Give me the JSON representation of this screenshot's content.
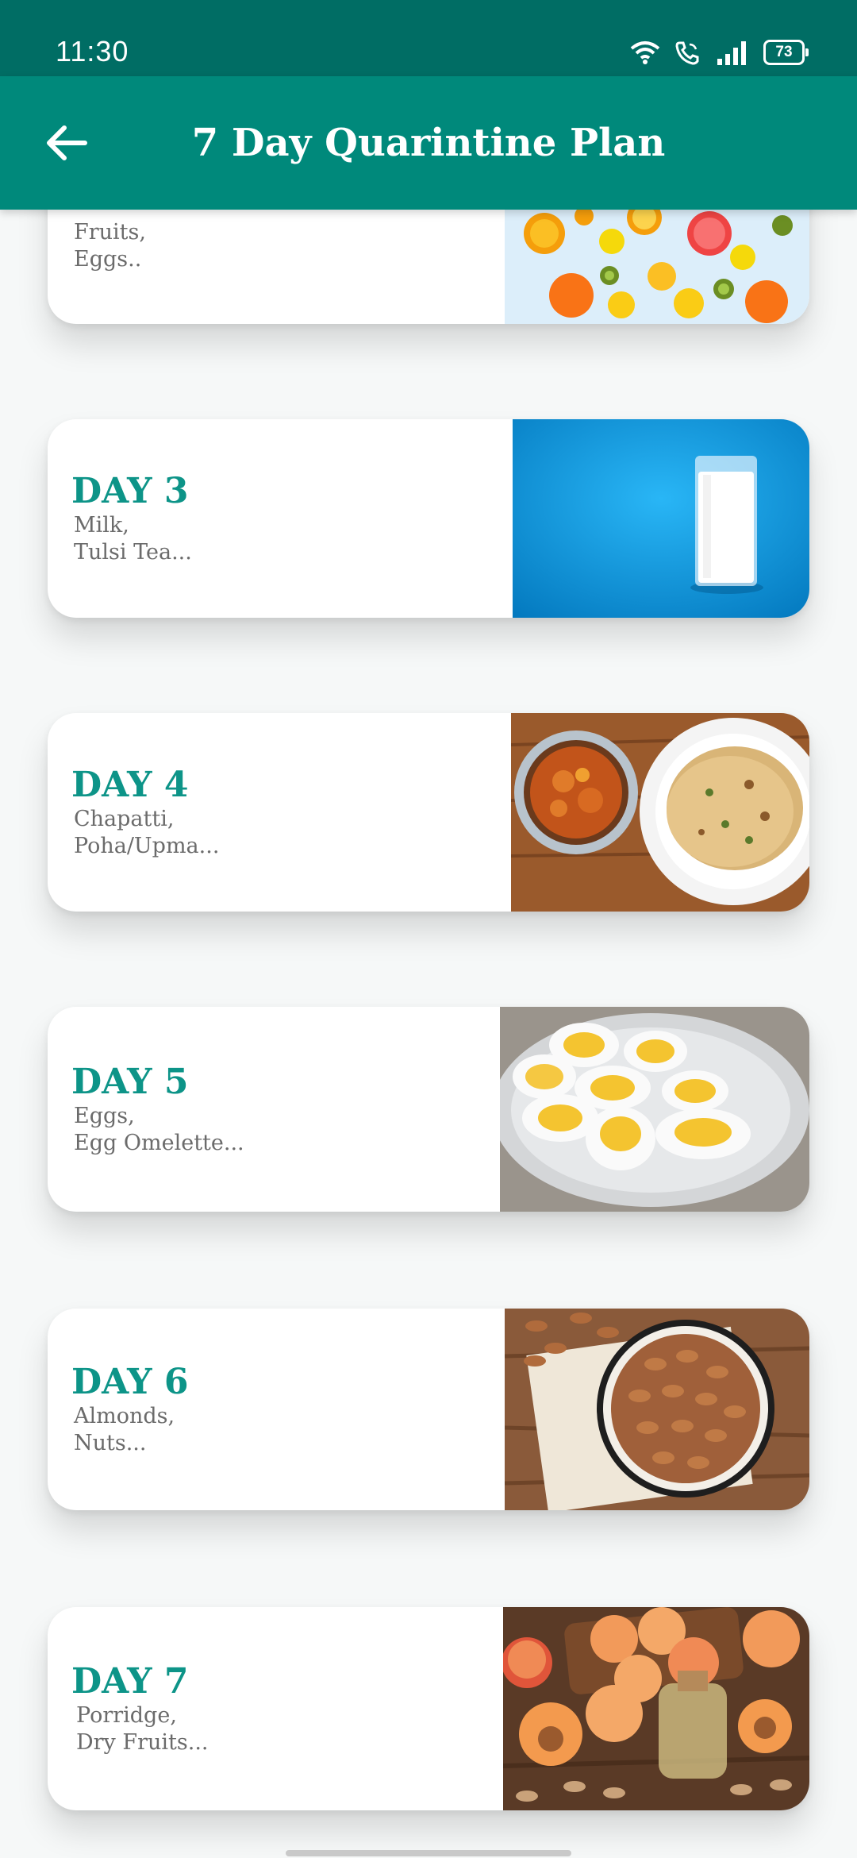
{
  "status_bar": {
    "time": "11:30",
    "battery_level": "73",
    "icons": [
      "wifi-icon",
      "wifi-calling-icon",
      "signal-icon",
      "battery-icon"
    ]
  },
  "app_bar": {
    "title": "7 Day Quarintine Plan",
    "back_icon": "arrow-left-icon",
    "color": "#00897b",
    "status_color": "#006d64"
  },
  "accent_color": "#0d9488",
  "cards": [
    {
      "title": "",
      "desc": "Fruits,\nEggs..",
      "image": "citrus-fruits-photo"
    },
    {
      "title": "DAY 3",
      "desc": "Milk,\nTulsi Tea...",
      "image": "glass-of-milk-photo"
    },
    {
      "title": "DAY 4",
      "desc": "Chapatti,\nPoha/Upma...",
      "image": "chapati-and-curry-photo"
    },
    {
      "title": "DAY 5",
      "desc": "Eggs,\nEgg Omelette...",
      "image": "boiled-eggs-photo"
    },
    {
      "title": "DAY 6",
      "desc": "Almonds,\nNuts...",
      "image": "almonds-bowl-photo"
    },
    {
      "title": "DAY 7",
      "desc": "Porridge,\nDry Fruits...",
      "image": "apricots-photo"
    }
  ]
}
